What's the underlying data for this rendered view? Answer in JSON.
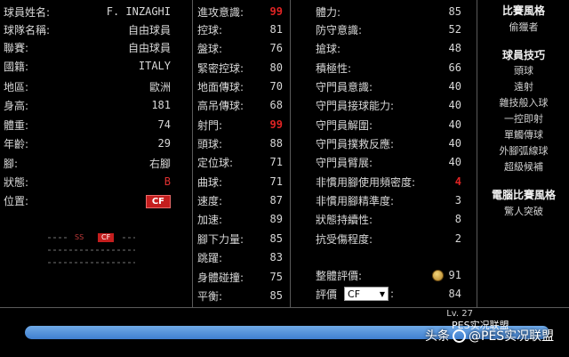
{
  "profile": [
    {
      "label": "球員姓名:",
      "value": "F. INZAGHI"
    },
    {
      "label": "球隊名稱:",
      "value": "自由球員"
    },
    {
      "label": "聯賽:",
      "value": "自由球員"
    },
    {
      "label": "國籍:",
      "value": "ITALY"
    },
    {
      "label": "地區:",
      "value": "歐洲"
    },
    {
      "label": "身高:",
      "value": "181"
    },
    {
      "label": "體重:",
      "value": "74"
    },
    {
      "label": "年齡:",
      "value": "29"
    },
    {
      "label": "腳:",
      "value": "右腳"
    },
    {
      "label": "狀態:",
      "value": "B"
    },
    {
      "label": "位置:",
      "value": "CF"
    }
  ],
  "position_map": {
    "sf": "SS",
    "cf": "CF"
  },
  "stats_mid": [
    {
      "label": "進攻意識:",
      "value": "99"
    },
    {
      "label": "控球:",
      "value": "81"
    },
    {
      "label": "盤球:",
      "value": "76"
    },
    {
      "label": "緊密控球:",
      "value": "80"
    },
    {
      "label": "地面傳球:",
      "value": "70"
    },
    {
      "label": "高吊傳球:",
      "value": "68"
    },
    {
      "label": "射門:",
      "value": "99"
    },
    {
      "label": "頭球:",
      "value": "88"
    },
    {
      "label": "定位球:",
      "value": "71"
    },
    {
      "label": "曲球:",
      "value": "71"
    },
    {
      "label": "速度:",
      "value": "87"
    },
    {
      "label": "加速:",
      "value": "89"
    },
    {
      "label": "腳下力量:",
      "value": "85"
    },
    {
      "label": "跳躍:",
      "value": "83"
    },
    {
      "label": "身體碰撞:",
      "value": "75"
    },
    {
      "label": "平衡:",
      "value": "85"
    }
  ],
  "stats_right": [
    {
      "label": "體力:",
      "value": "85"
    },
    {
      "label": "防守意識:",
      "value": "52"
    },
    {
      "label": "搶球:",
      "value": "48"
    },
    {
      "label": "積極性:",
      "value": "66"
    },
    {
      "label": "守門員意識:",
      "value": "40"
    },
    {
      "label": "守門員接球能力:",
      "value": "40"
    },
    {
      "label": "守門員解圍:",
      "value": "40"
    },
    {
      "label": "守門員撲救反應:",
      "value": "40"
    },
    {
      "label": "守門員臂展:",
      "value": "40"
    },
    {
      "label": "非慣用腳使用頻密度:",
      "value": "4"
    },
    {
      "label": "非慣用腳精準度:",
      "value": "3"
    },
    {
      "label": "狀態持續性:",
      "value": "8"
    },
    {
      "label": "抗受傷程度:",
      "value": "2"
    }
  ],
  "overall": {
    "label": "整體評價:",
    "value": "91"
  },
  "rating": {
    "label": "評價",
    "selected": "CF",
    "value": "84"
  },
  "sidebar": {
    "playstyle_title": "比賽風格",
    "playstyle": "偷獵者",
    "skills_title": "球員技巧",
    "skills": [
      "頭球",
      "遠射",
      "雜技般入球",
      "一控即射",
      "單觸傳球",
      "外腳弧線球",
      "超級候補"
    ],
    "ai_title": "電腦比賽風格",
    "ai_style": "驚人突破"
  },
  "level": "Lv. 27",
  "watermark": {
    "prefix": "头条",
    "top": "PES实况联盟",
    "main": "@PES实况联盟"
  },
  "colors": {
    "highlight_red": "#e02424",
    "badge_red": "#c41e1e",
    "xp_bar": "#4f8fdc",
    "coin_gold": "#d4a43a"
  }
}
